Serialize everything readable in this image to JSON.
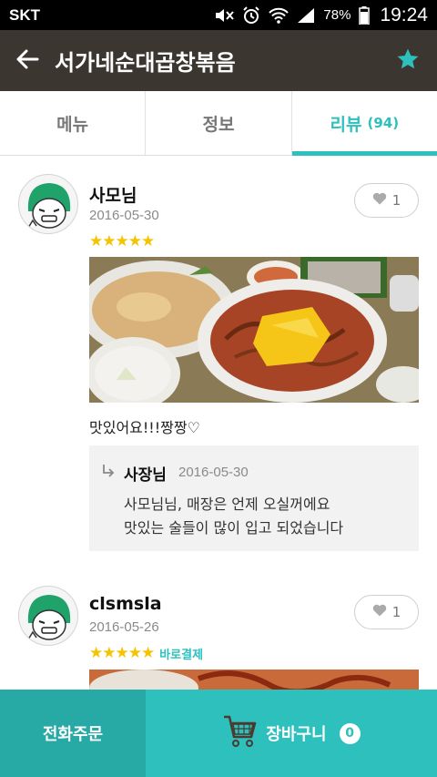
{
  "status_bar": {
    "carrier": "SKT",
    "battery": "78%",
    "time": "19:24",
    "icons": [
      "mute-icon",
      "alarm-icon",
      "wifi-icon",
      "signal-icon",
      "battery-icon"
    ]
  },
  "app_bar": {
    "title": "서가네순대곱창볶음",
    "back_icon": "back-arrow-icon",
    "favorite_icon": "star-icon"
  },
  "tabs": [
    {
      "label": "메뉴",
      "active": false
    },
    {
      "label": "정보",
      "active": false
    },
    {
      "label": "리뷰",
      "count": "(94)",
      "active": true
    }
  ],
  "reviews": [
    {
      "author": "사모님",
      "date": "2016-05-30",
      "likes": "1",
      "stars": "★★★★★",
      "rating": 5,
      "text": "맛있어요!!!짱짱♡",
      "reply": {
        "author": "사장님",
        "date": "2016-05-30",
        "line1": "사모님님, 매장은 언제 오실꺼에요",
        "line2": "맛있는 술들이 많이 입고 되었습니다"
      }
    },
    {
      "author": "clsmsla",
      "date": "2016-05-26",
      "likes": "1",
      "stars": "★★★★★",
      "rating": 5,
      "badge": "바로결제"
    }
  ],
  "bottom_bar": {
    "phone_order": "전화주문",
    "cart_label": "장바구니",
    "cart_count": "0"
  },
  "colors": {
    "accent": "#2ec0bd",
    "app_bar": "#3c3631",
    "star": "#f5c400"
  }
}
